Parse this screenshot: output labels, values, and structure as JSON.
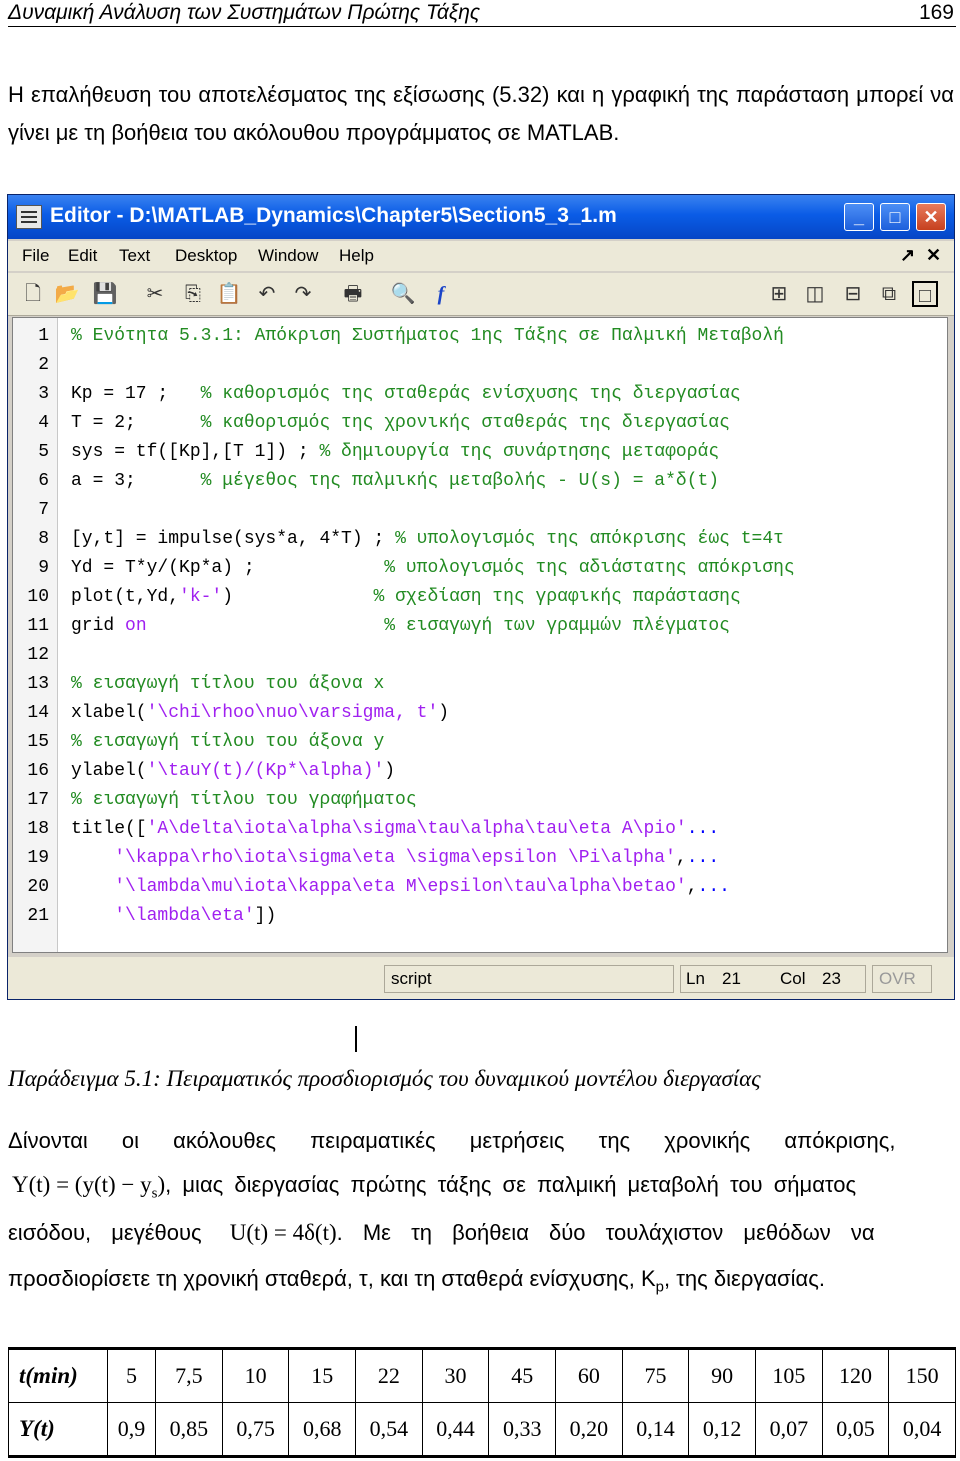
{
  "header": {
    "chapter": "Δυναμική Ανάλυση των Συστημάτων Πρώτης Τάξης",
    "page": "169"
  },
  "intro": "Η επαλήθευση του αποτελέσματος της εξίσωσης (5.32) και η γραφική της παράσταση μπορεί να γίνει με τη βοήθεια του ακόλουθου προγράμματος σε MATLAB.",
  "editor": {
    "title": "Editor - D:\\MATLAB_Dynamics\\Chapter5\\Section5_3_1.m",
    "menu": [
      "File",
      "Edit",
      "Text",
      "Desktop",
      "Window",
      "Help"
    ],
    "lines": [
      {
        "n": "1",
        "parts": [
          {
            "t": "% Ενότητα 5.3.1: Απόκριση Συστήματος 1ης Τάξης σε Παλμική Μεταβολή",
            "c": "cmt"
          }
        ]
      },
      {
        "n": "2",
        "parts": []
      },
      {
        "n": "3",
        "parts": [
          {
            "t": "Kp = 17 ;   ",
            "c": ""
          },
          {
            "t": "% καθορισμός της σταθεράς ενίσχυσης της διεργασίας",
            "c": "cmt"
          }
        ]
      },
      {
        "n": "4",
        "parts": [
          {
            "t": "T = 2;      ",
            "c": ""
          },
          {
            "t": "% καθορισμός της χρονικής σταθεράς της διεργασίας",
            "c": "cmt"
          }
        ]
      },
      {
        "n": "5",
        "parts": [
          {
            "t": "sys = tf([Kp],[T 1]) ; ",
            "c": ""
          },
          {
            "t": "% δημιουργία της συνάρτησης μεταφοράς",
            "c": "cmt"
          }
        ]
      },
      {
        "n": "6",
        "parts": [
          {
            "t": "a = 3;      ",
            "c": ""
          },
          {
            "t": "% μέγεθος της παλμικής μεταβολής - U(s) = a*δ(t)",
            "c": "cmt"
          }
        ]
      },
      {
        "n": "7",
        "parts": []
      },
      {
        "n": "8",
        "parts": [
          {
            "t": "[y,t] = impulse(sys*a, 4*T) ; ",
            "c": ""
          },
          {
            "t": "% υπολογισμός της απόκρισης έως t=4τ",
            "c": "cmt"
          }
        ]
      },
      {
        "n": "9",
        "parts": [
          {
            "t": "Yd = T*y/(Kp*a) ;            ",
            "c": ""
          },
          {
            "t": "% υπολογισμός της αδιάστατης απόκρισης",
            "c": "cmt"
          }
        ]
      },
      {
        "n": "10",
        "parts": [
          {
            "t": "plot(t,Yd,",
            "c": ""
          },
          {
            "t": "'k-'",
            "c": "str"
          },
          {
            "t": ")             ",
            "c": ""
          },
          {
            "t": "% σχεδίαση της γραφικής παράστασης",
            "c": "cmt"
          }
        ]
      },
      {
        "n": "11",
        "parts": [
          {
            "t": "grid ",
            "c": ""
          },
          {
            "t": "on",
            "c": "str"
          },
          {
            "t": "                      ",
            "c": ""
          },
          {
            "t": "% εισαγωγή των γραμμών πλέγματος",
            "c": "cmt"
          }
        ]
      },
      {
        "n": "12",
        "parts": []
      },
      {
        "n": "13",
        "parts": [
          {
            "t": "% εισαγωγή τίτλου του άξονα x",
            "c": "cmt"
          }
        ]
      },
      {
        "n": "14",
        "parts": [
          {
            "t": "xlabel(",
            "c": ""
          },
          {
            "t": "'\\chi\\rhoo\\nuo\\varsigma, t'",
            "c": "str"
          },
          {
            "t": ")",
            "c": ""
          }
        ]
      },
      {
        "n": "15",
        "parts": [
          {
            "t": "% εισαγωγή τίτλου του άξονα y",
            "c": "cmt"
          }
        ]
      },
      {
        "n": "16",
        "parts": [
          {
            "t": "ylabel(",
            "c": ""
          },
          {
            "t": "'\\tauY(t)/(Kp*\\alpha)'",
            "c": "str"
          },
          {
            "t": ")",
            "c": ""
          }
        ]
      },
      {
        "n": "17",
        "parts": [
          {
            "t": "% εισαγωγή τίτλου του γραφήματος",
            "c": "cmt"
          }
        ]
      },
      {
        "n": "18",
        "parts": [
          {
            "t": "title([",
            "c": ""
          },
          {
            "t": "'A\\delta\\iota\\alpha\\sigma\\tau\\alpha\\tau\\eta A\\pio'",
            "c": "str"
          },
          {
            "t": "...",
            "c": "kw"
          }
        ]
      },
      {
        "n": "19",
        "parts": [
          {
            "t": "    ",
            "c": ""
          },
          {
            "t": "'\\kappa\\rho\\iota\\sigma\\eta \\sigma\\epsilon \\Pi\\alpha'",
            "c": "str"
          },
          {
            "t": ",",
            "c": ""
          },
          {
            "t": "...",
            "c": "kw"
          }
        ]
      },
      {
        "n": "20",
        "parts": [
          {
            "t": "    ",
            "c": ""
          },
          {
            "t": "'\\lambda\\mu\\iota\\kappa\\eta M\\epsilon\\tau\\alpha\\betao'",
            "c": "str"
          },
          {
            "t": ",",
            "c": ""
          },
          {
            "t": "...",
            "c": "kw"
          }
        ]
      },
      {
        "n": "21",
        "parts": [
          {
            "t": "    ",
            "c": ""
          },
          {
            "t": "'\\lambda\\eta'",
            "c": "str"
          },
          {
            "t": "])",
            "c": ""
          }
        ]
      }
    ],
    "status": {
      "mode": "script",
      "ln_label": "Ln",
      "ln": "21",
      "col_label": "Col",
      "col": "23",
      "ovr": "OVR"
    }
  },
  "example": {
    "title": "Παράδειγμα 5.1: Πειραματικός προσδιορισμός του δυναμικού μοντέλου διεργασίας",
    "line1": "Δίνονται οι ακόλουθες πειραματικές μετρήσεις της χρονικής απόκρισης,",
    "eq_Y": "Y(t) = (y(t) − y",
    "eq_Y_sub": "s",
    "eq_Y_close": ")",
    "line2_rest": ", μιας διεργασίας πρώτης τάξης σε παλμική μεταβολή του σήματος",
    "line3_a": "εισόδου, μεγέθους",
    "eq_U": "U(t) = 4δ(t)",
    "line3_b": ". Με τη βοήθεια δύο τουλάχιστον μεθόδων να",
    "line4_a": "προσδιορίσετε τη χρονική σταθερά, τ, και τη σταθερά ενίσχυσης, K",
    "line4_sub": "p",
    "line4_b": ", της διεργασίας."
  },
  "table": {
    "row_headers": [
      "t(min)",
      "Y(t)"
    ],
    "t": [
      "5",
      "7,5",
      "10",
      "15",
      "22",
      "30",
      "45",
      "60",
      "75",
      "90",
      "105",
      "120",
      "150"
    ],
    "y": [
      "0,9",
      "0,85",
      "0,75",
      "0,68",
      "0,54",
      "0,44",
      "0,33",
      "0,20",
      "0,14",
      "0,12",
      "0,07",
      "0,05",
      "0,04"
    ]
  }
}
